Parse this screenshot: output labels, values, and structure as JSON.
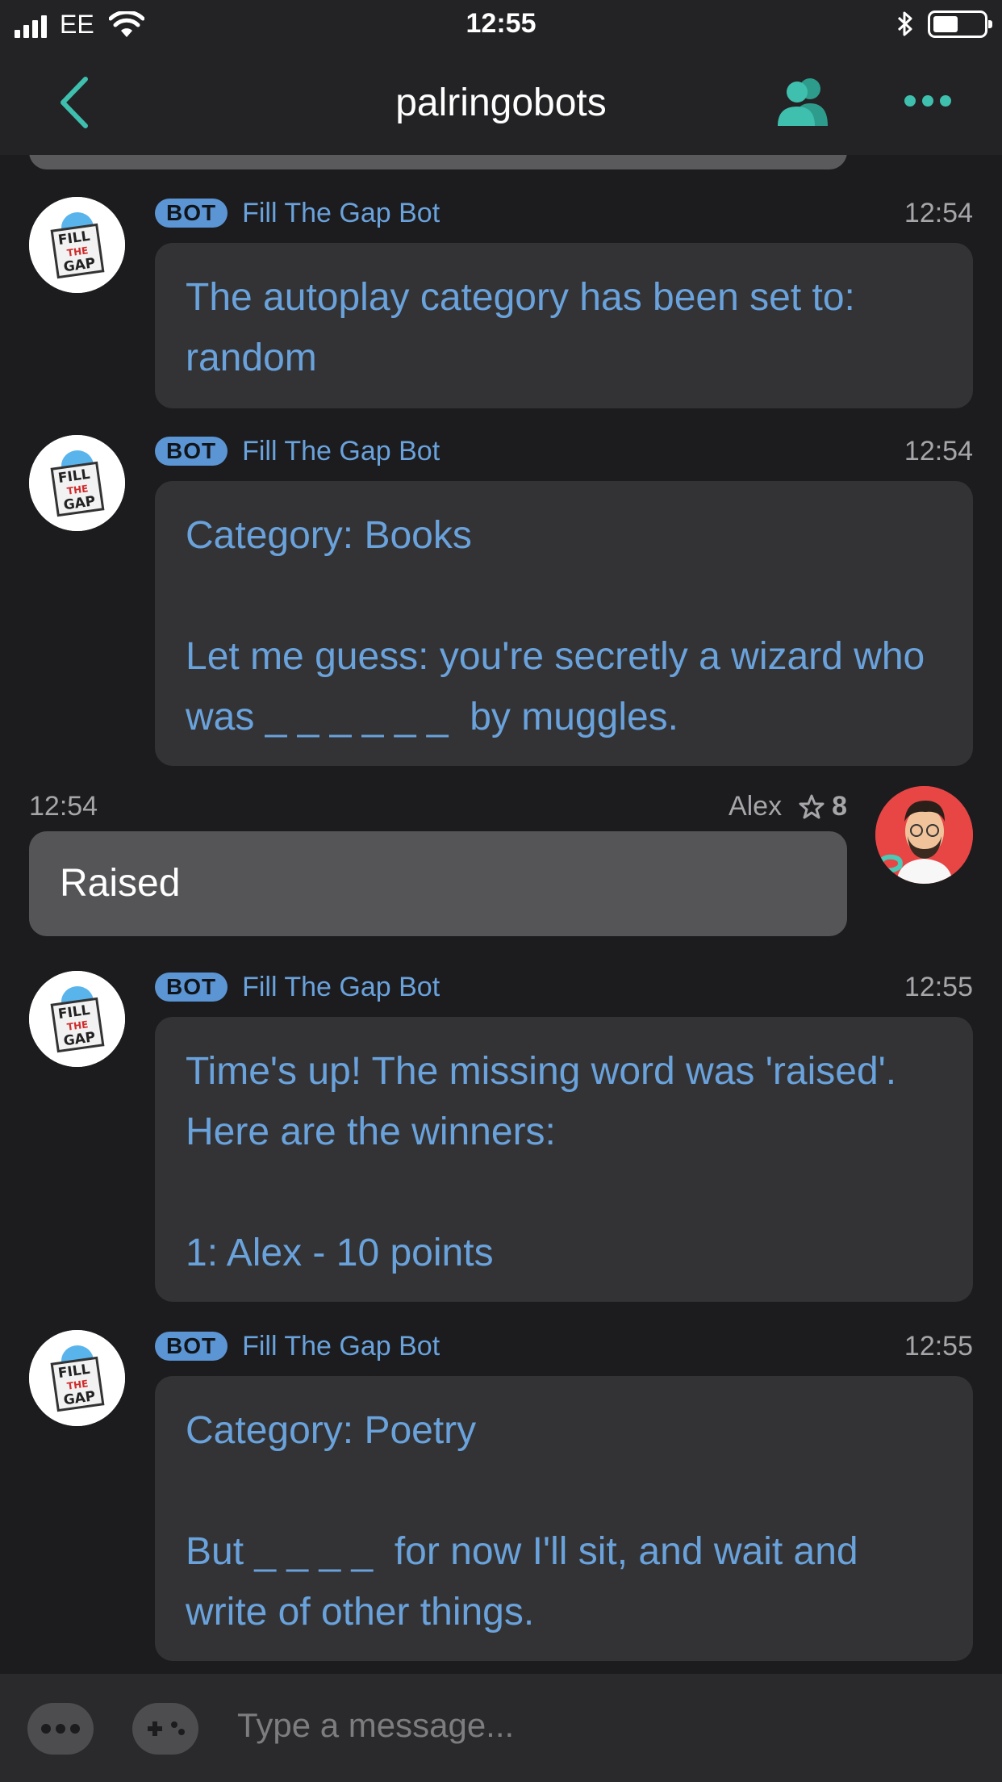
{
  "status_bar": {
    "carrier": "EE",
    "time": "12:55"
  },
  "nav": {
    "title": "palringobots",
    "accent_color": "#3fbfae"
  },
  "messages": [
    {
      "type": "bot",
      "badge": "BOT",
      "sender": "Fill The Gap Bot",
      "time": "12:54",
      "text": "The autoplay category has been set to: random"
    },
    {
      "type": "bot",
      "badge": "BOT",
      "sender": "Fill The Gap Bot",
      "time": "12:54",
      "text": "Category: Books\n\nLet me guess: you're secretly a wizard who was _ _ _ _ _ _  by muggles."
    },
    {
      "type": "user",
      "sender": "Alex",
      "time": "12:54",
      "reputation": "8",
      "text": "Raised"
    },
    {
      "type": "bot",
      "badge": "BOT",
      "sender": "Fill The Gap Bot",
      "time": "12:55",
      "text": "Time's up! The missing word was 'raised'. Here are the winners:\n\n1: Alex - 10 points"
    },
    {
      "type": "bot",
      "badge": "BOT",
      "sender": "Fill The Gap Bot",
      "time": "12:55",
      "text": "Category: Poetry\n\nBut _ _ _ _  for now I'll sit, and wait and write of other things."
    }
  ],
  "composer": {
    "placeholder": "Type a message..."
  },
  "icons": {
    "back": "chevron-left-icon",
    "members": "people-icon",
    "more": "more-dots-icon",
    "star": "star-outline-icon",
    "game": "gamepad-icon"
  }
}
